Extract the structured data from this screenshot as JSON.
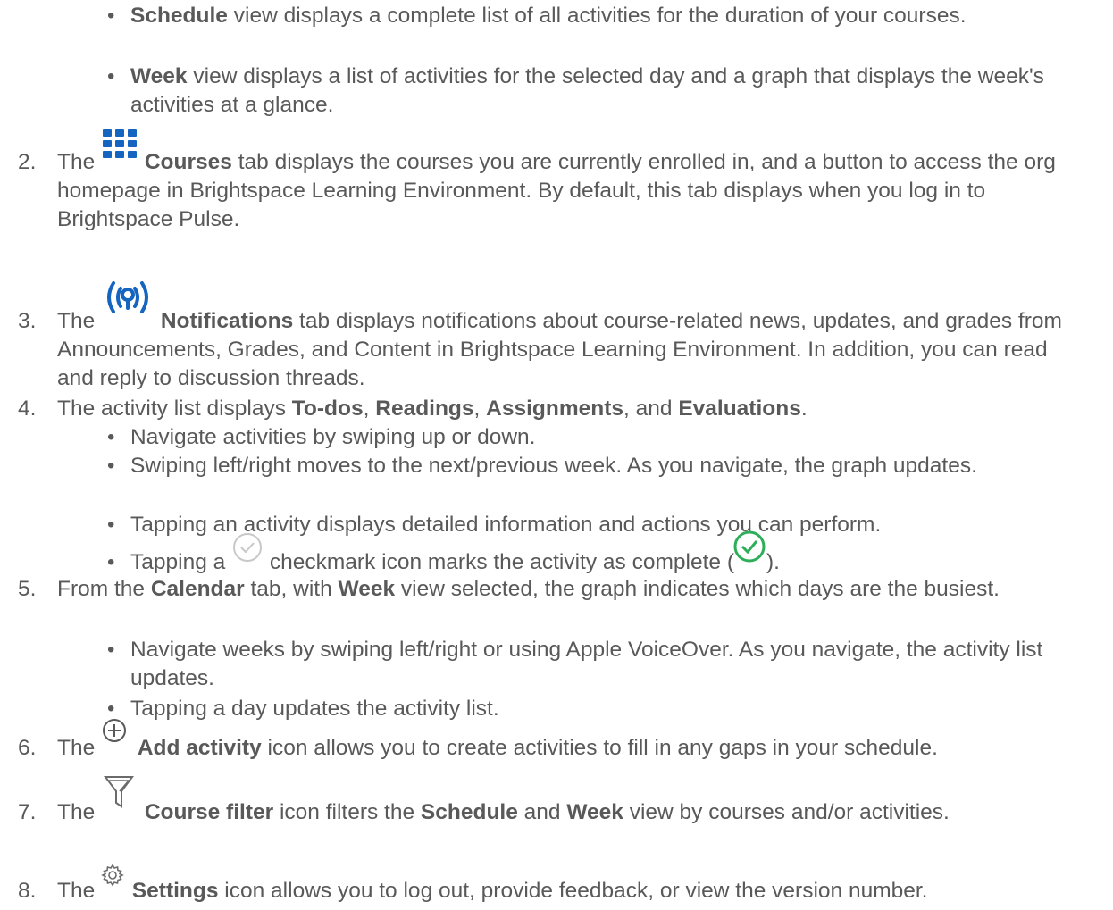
{
  "schedule_item": {
    "bold": "Schedule",
    "text": " view displays a complete list of all activities for the duration of your courses."
  },
  "week_item": {
    "bold": "Week",
    "text": " view displays a list of activities for the selected day and a graph that displays the week's activities at a glance."
  },
  "items": {
    "i2": {
      "num": "2.",
      "pre": "The ",
      "bold": "Courses",
      "text": " tab displays the courses you are currently enrolled in, and a button to access the org homepage in Brightspace Learning Environment. By default, this tab displays when you log in to Brightspace Pulse.",
      "icon": "grid-icon"
    },
    "i3": {
      "num": "3.",
      "pre": "The ",
      "bold": "Notifications",
      "text": " tab displays notifications about course-related news, updates, and grades from Announcements, Grades, and Content in Brightspace Learning Environment. In addition, you can read and reply to discussion threads.",
      "icon": "broadcast-icon"
    },
    "i4": {
      "num": "4.",
      "pre": "The activity list displays ",
      "b1": "To-dos",
      "s1": ", ",
      "b2": "Readings",
      "s2": ", ",
      "b3": "Assignments",
      "s3": ", and ",
      "b4": "Evaluations",
      "s4": "."
    },
    "i4_sub": [
      "Navigate activities by swiping up or down.",
      "Swiping left/right moves to the next/previous week. As you navigate, the graph updates.",
      "Tapping an activity displays detailed information and actions you can perform."
    ],
    "i4_sub4": {
      "pre": "Tapping a ",
      "post": " checkmark icon marks the activity as complete (",
      "end": ")."
    },
    "i5": {
      "num": "5.",
      "pre": "From the ",
      "b1": "Calendar",
      "mid": " tab, with ",
      "b2": "Week",
      "post": " view selected, the graph indicates which days are the busiest."
    },
    "i5_sub": [
      "Navigate weeks by swiping left/right or using Apple VoiceOver. As you navigate, the activity list updates.",
      "Tapping a day updates the activity list."
    ],
    "i6": {
      "num": "6.",
      "pre": "The ",
      "bold": "Add activity",
      "text": " icon allows you to create activities to fill in any gaps in your schedule.",
      "icon": "plus-circle-icon"
    },
    "i7": {
      "num": "7.",
      "pre": "The ",
      "b1": "Course filter",
      "mid": " icon filters the ",
      "b2": "Schedule",
      "mid2": " and ",
      "b3": "Week",
      "post": " view by courses and/or activities.",
      "icon": "filter-icon"
    },
    "i8": {
      "num": "8.",
      "pre": "The ",
      "bold": "Settings",
      "text": " icon allows you to log out, provide feedback, or view the version number.",
      "icon": "gear-icon"
    }
  },
  "bullet": "•",
  "colors": {
    "text": "#595959",
    "accent_blue": "#1565c0",
    "check_green": "#2eae5a",
    "check_gray": "#c8c8c8",
    "icon_gray": "#6b6b6b"
  }
}
